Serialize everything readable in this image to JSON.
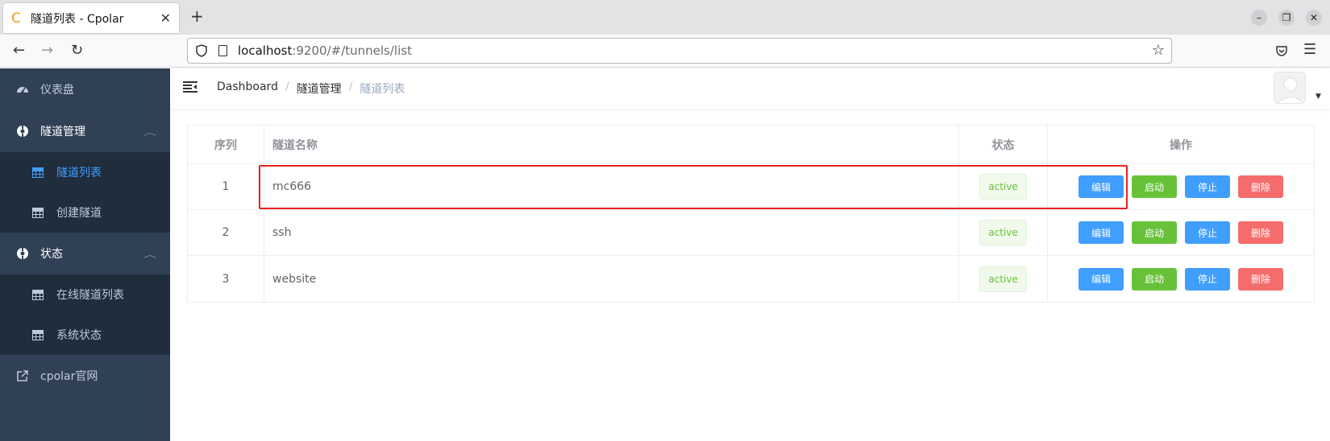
{
  "browser": {
    "tab_title": "隧道列表 - Cpolar",
    "tab_favicon": "C",
    "new_tab_glyph": "+",
    "close_glyph": "✕",
    "url_host": "localhost",
    "url_rest": ":9200/#/tunnels/list"
  },
  "sidebar": {
    "items": [
      {
        "label": "仪表盘",
        "icon": "dashboard-icon"
      },
      {
        "label": "隧道管理",
        "icon": "tunnel-manage-icon"
      },
      {
        "label": "状态",
        "icon": "status-icon"
      },
      {
        "label": "cpolar官网",
        "icon": "external-link-icon"
      }
    ],
    "tunnel_sub": [
      {
        "label": "隧道列表",
        "active": true
      },
      {
        "label": "创建隧道",
        "active": false
      }
    ],
    "status_sub": [
      {
        "label": "在线隧道列表"
      },
      {
        "label": "系统状态"
      }
    ]
  },
  "breadcrumb": [
    "Dashboard",
    "隧道管理",
    "隧道列表"
  ],
  "table": {
    "headers": [
      "序列",
      "隧道名称",
      "状态",
      "操作"
    ],
    "rows": [
      {
        "index": "1",
        "name": "mc666",
        "status": "active"
      },
      {
        "index": "2",
        "name": "ssh",
        "status": "active"
      },
      {
        "index": "3",
        "name": "website",
        "status": "active"
      }
    ],
    "actions": {
      "edit": "编辑",
      "start": "启动",
      "stop": "停止",
      "delete": "删除"
    }
  },
  "colors": {
    "sidebar_bg": "#304156",
    "submenu_bg": "#1f2d3d",
    "accent": "#409eff",
    "success": "#67c23a",
    "danger": "#f56c6c",
    "highlight": "#e8221f"
  }
}
